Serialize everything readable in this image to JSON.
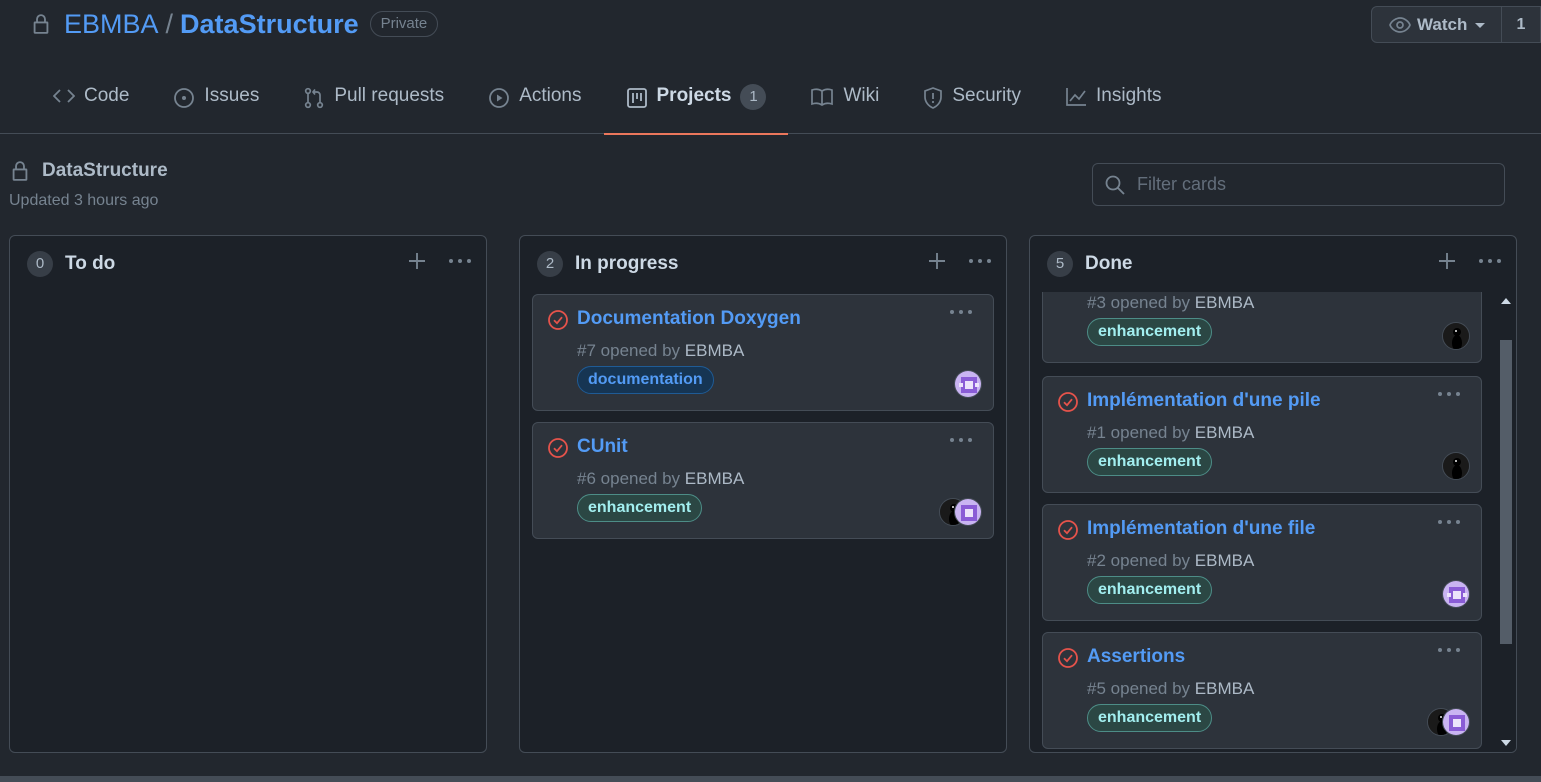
{
  "repo": {
    "owner": "EBMBA",
    "separator": "/",
    "name": "DataStructure",
    "visibility": "Private",
    "watch_label": "Watch",
    "watch_count": "1"
  },
  "tabs": [
    {
      "label": "Code",
      "icon": "code-icon"
    },
    {
      "label": "Issues",
      "icon": "issue-icon"
    },
    {
      "label": "Pull requests",
      "icon": "pull-request-icon"
    },
    {
      "label": "Actions",
      "icon": "play-icon"
    },
    {
      "label": "Projects",
      "icon": "project-icon",
      "count": "1",
      "selected": true
    },
    {
      "label": "Wiki",
      "icon": "book-icon"
    },
    {
      "label": "Security",
      "icon": "shield-icon"
    },
    {
      "label": "Insights",
      "icon": "graph-icon"
    }
  ],
  "project": {
    "title": "DataStructure",
    "updated": "Updated 3 hours ago",
    "filter_placeholder": "Filter cards"
  },
  "columns": [
    {
      "name": "To do",
      "count": "0",
      "cards": []
    },
    {
      "name": "In progress",
      "count": "2",
      "cards": [
        {
          "title": "Documentation Doxygen",
          "number": "#7",
          "opened_by": "opened by",
          "author": "EBMBA",
          "label": "documentation"
        },
        {
          "title": "CUnit",
          "number": "#6",
          "opened_by": "opened by",
          "author": "EBMBA",
          "label": "enhancement"
        }
      ]
    },
    {
      "name": "Done",
      "count": "5",
      "cards": [
        {
          "number": "#3",
          "opened_by": "opened by",
          "author": "EBMBA",
          "label": "enhancement"
        },
        {
          "title": "Implémentation d'une pile",
          "number": "#1",
          "opened_by": "opened by",
          "author": "EBMBA",
          "label": "enhancement"
        },
        {
          "title": "Implémentation d'une file",
          "number": "#2",
          "opened_by": "opened by",
          "author": "EBMBA",
          "label": "enhancement"
        },
        {
          "title": "Assertions",
          "number": "#5",
          "opened_by": "opened by",
          "author": "EBMBA",
          "label": "enhancement"
        }
      ]
    }
  ],
  "colors": {
    "link": "#539bf5",
    "closed_issue": "#e5534b",
    "selected_tab_underline": "#ec775c",
    "enhancement_label": "#a2eeef",
    "documentation_label": "#539bf5"
  }
}
